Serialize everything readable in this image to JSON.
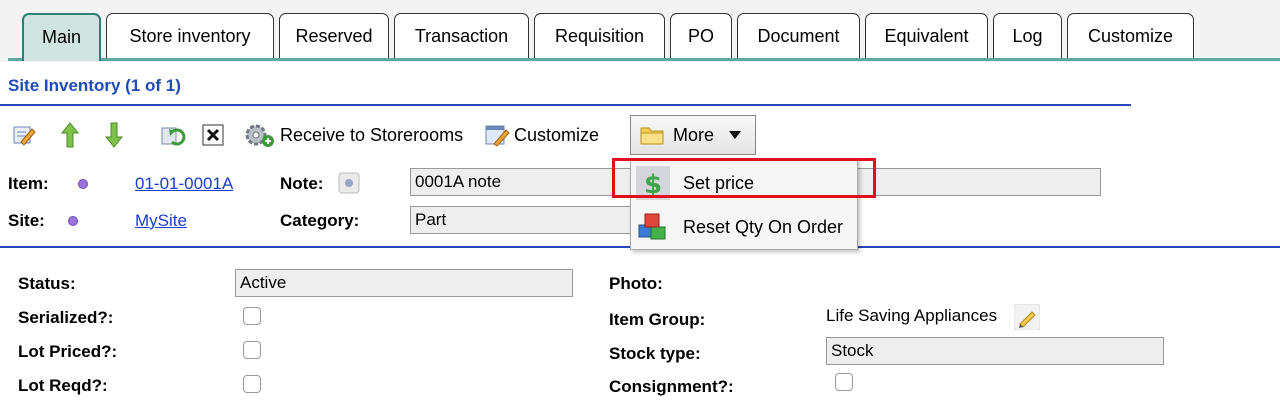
{
  "tabs": [
    {
      "label": "Main",
      "active": true
    },
    {
      "label": "Store inventory"
    },
    {
      "label": "Reserved"
    },
    {
      "label": "Transaction"
    },
    {
      "label": "Requisition"
    },
    {
      "label": "PO"
    },
    {
      "label": "Document"
    },
    {
      "label": "Equivalent"
    },
    {
      "label": "Log"
    },
    {
      "label": "Customize"
    }
  ],
  "section_title": "Site Inventory (1 of 1)",
  "toolbar": {
    "receive_label": "Receive to Storerooms",
    "customize_label": "Customize",
    "more_label": "More"
  },
  "header_fields": {
    "item_label": "Item:",
    "item_value": "01-01-0001A",
    "site_label": "Site:",
    "site_value": "MySite",
    "note_label": "Note:",
    "note_value": "0001A note",
    "category_label": "Category:",
    "category_value": "Part"
  },
  "more_menu": {
    "items": [
      {
        "label": "Set price",
        "icon": "dollar-icon"
      },
      {
        "label": "Reset Qty On Order",
        "icon": "boxes-icon"
      }
    ]
  },
  "details": {
    "status_label": "Status:",
    "status_value": "Active",
    "serialized_label": "Serialized?:",
    "lot_priced_label": "Lot Priced?:",
    "lot_reqd_label": "Lot Reqd?:",
    "photo_label": "Photo:",
    "item_group_label": "Item Group:",
    "item_group_value": "Life Saving Appliances",
    "stock_type_label": "Stock type:",
    "stock_type_value": "Stock",
    "consignment_label": "Consignment?:"
  },
  "colors": {
    "accent": "#1f4bb5",
    "highlight": "#e0101c",
    "active_tab": "#cfe3e0"
  }
}
